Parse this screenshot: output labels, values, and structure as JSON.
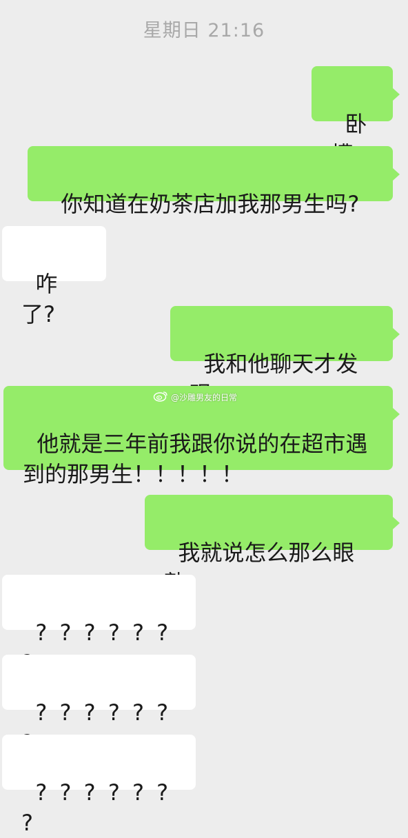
{
  "chat": {
    "timestamp": "星期日  21:16",
    "messages": [
      {
        "side": "sent",
        "text": "卧槽"
      },
      {
        "side": "sent",
        "text": "你知道在奶茶店加我那男生吗?"
      },
      {
        "side": "received",
        "text": "咋了?"
      },
      {
        "side": "sent",
        "text": "我和他聊天才发现"
      },
      {
        "side": "sent",
        "text": "他就是三年前我跟你说的在超市遇到的那男生！！！！！"
      },
      {
        "side": "sent",
        "text": "我就说怎么那么眼熟"
      },
      {
        "side": "received",
        "text": "? ? ? ? ? ? ?"
      },
      {
        "side": "received",
        "text": "? ? ? ? ? ? ?"
      },
      {
        "side": "received",
        "text": "? ? ? ? ? ? ?"
      }
    ]
  },
  "watermark": {
    "text": "@沙雕男友的日常",
    "icon": "weibo-icon"
  },
  "colors": {
    "background": "#ededed",
    "sent_bubble": "#95ec69",
    "received_bubble": "#ffffff",
    "timestamp_text": "#a8a8a8"
  }
}
